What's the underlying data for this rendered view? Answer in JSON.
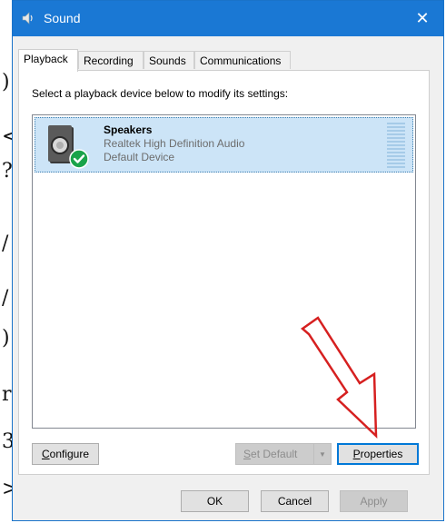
{
  "edge_glyphs": [
    ")",
    "<",
    "?",
    "/",
    "/",
    ")",
    "r",
    "3",
    ">"
  ],
  "window": {
    "title": "Sound",
    "close_glyph": "✕"
  },
  "tabs": [
    {
      "label": "Playback",
      "active": true
    },
    {
      "label": "Recording",
      "active": false
    },
    {
      "label": "Sounds",
      "active": false
    },
    {
      "label": "Communications",
      "active": false
    }
  ],
  "playback": {
    "instruction": "Select a playback device below to modify its settings:",
    "devices": [
      {
        "name": "Speakers",
        "driver": "Realtek High Definition Audio",
        "status": "Default Device",
        "icon": "speaker-icon",
        "status_icon": "green-check-icon",
        "selected": true
      }
    ],
    "buttons": {
      "configure": {
        "label": "Configure",
        "underline": "C",
        "rest": "onfigure"
      },
      "set_default": {
        "label": "Set Default",
        "underline": "S",
        "rest": "et Default",
        "enabled": false
      },
      "properties": {
        "label": "Properties",
        "underline": "P",
        "rest": "roperties",
        "focused": true
      }
    }
  },
  "dialog_buttons": {
    "ok": "OK",
    "cancel": "Cancel",
    "apply": "Apply"
  },
  "colors": {
    "titlebar": "#1a78d4",
    "selection": "#cce4f7",
    "annotation_arrow": "#d62020",
    "check": "#1aa34a"
  }
}
